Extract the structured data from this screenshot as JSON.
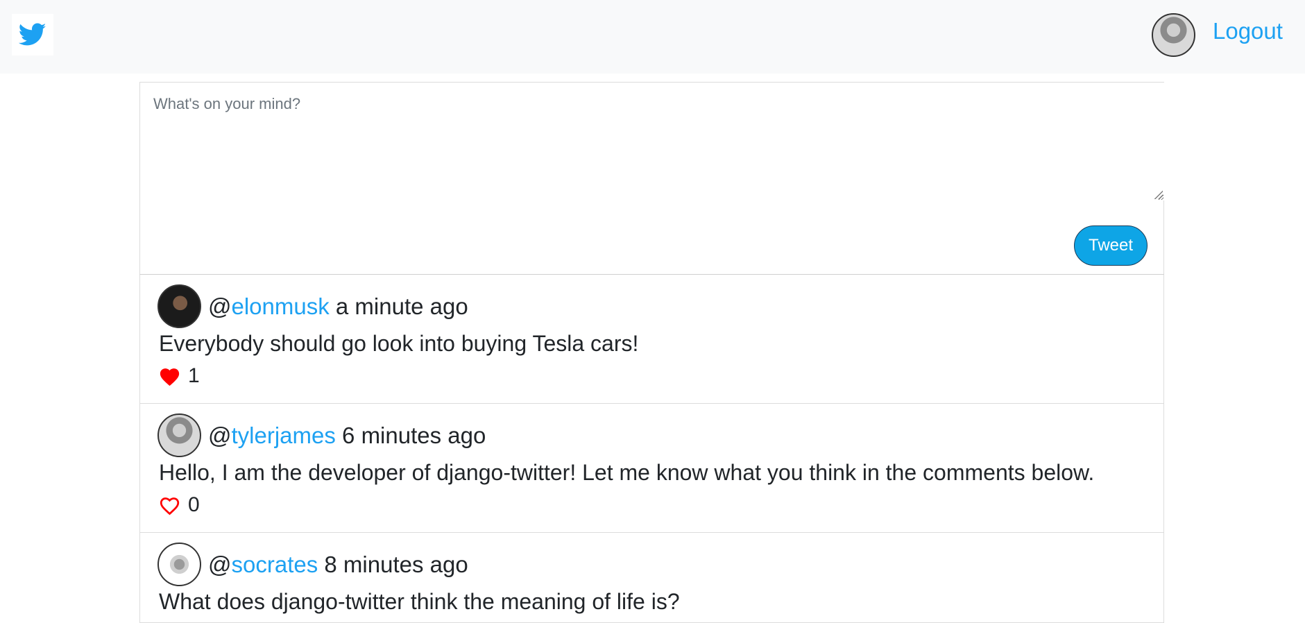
{
  "navbar": {
    "brand_icon": "twitter-bird-icon",
    "brand_color": "#1da1f2",
    "logout_label": "Logout"
  },
  "compose": {
    "placeholder": "What's on your mind?",
    "tweet_button_label": "Tweet",
    "button_color": "#0ea5e6"
  },
  "tweets": [
    {
      "at": "@",
      "handle": "elonmusk",
      "time": "a minute ago",
      "body": "Everybody should go look into buying Tesla cars!",
      "liked": true,
      "likes": "1"
    },
    {
      "at": "@",
      "handle": "tylerjames",
      "time": "6 minutes ago",
      "body": "Hello, I am the developer of django-twitter! Let me know what you think in the comments below.",
      "liked": false,
      "likes": "0"
    },
    {
      "at": "@",
      "handle": "socrates",
      "time": "8 minutes ago",
      "body": "What does django-twitter think the meaning of life is?"
    }
  ],
  "colors": {
    "link": "#1da1f2",
    "heart": "#ff0000",
    "navbar_bg": "#f8f9fa"
  }
}
